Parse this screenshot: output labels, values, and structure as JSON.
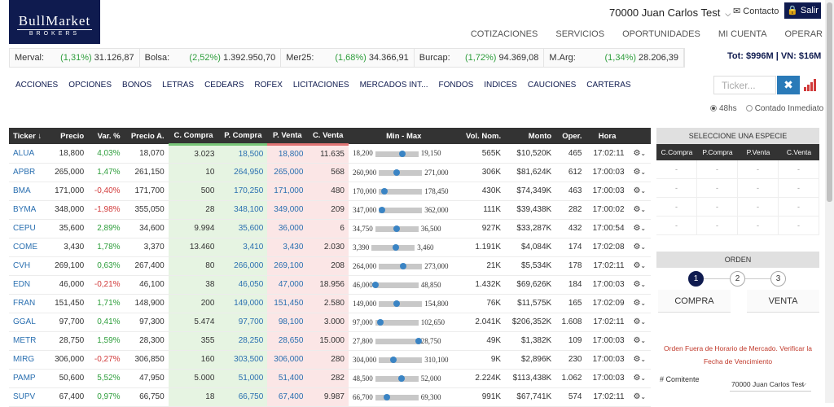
{
  "header": {
    "logo_line1": "BullMarket",
    "logo_line2": "BROKERS",
    "user": "70000 Juan Carlos Test",
    "contact": "Contacto",
    "logout": "Salir",
    "nav": [
      "COTIZACIONES",
      "SERVICIOS",
      "OPORTUNIDADES",
      "MI CUENTA",
      "OPERAR"
    ]
  },
  "ticker_bar": [
    {
      "name": "Merval:",
      "pct": "(1,31%)",
      "value": "31.126,87"
    },
    {
      "name": "Bolsa:",
      "pct": "(2,52%)",
      "value": "1.392.950,70"
    },
    {
      "name": "Mer25:",
      "pct": "(1,68%)",
      "value": "34.366,91"
    },
    {
      "name": "Burcap:",
      "pct": "(1,72%)",
      "value": "94.369,08"
    },
    {
      "name": "M.Arg:",
      "pct": "(1,34%)",
      "value": "28.206,39"
    }
  ],
  "totals": "Tot: $996M | VN: $16M",
  "categories": [
    "ACCIONES",
    "OPCIONES",
    "BONOS",
    "LETRAS",
    "CEDEARS",
    "ROFEX",
    "LICITACIONES",
    "MERCADOS INT...",
    "FONDOS",
    "INDICES",
    "CAUCIONES",
    "CARTERAS"
  ],
  "search": {
    "placeholder": "Ticker..."
  },
  "settlement": {
    "opt1": "48hs",
    "opt2": "Contado Inmediato"
  },
  "table": {
    "headers": [
      "Ticker ↓",
      "Precio",
      "Var. %",
      "Precio A.",
      "C. Compra",
      "P. Compra",
      "P. Venta",
      "C. Venta",
      "Min - Max",
      "Vol. Nom.",
      "Monto",
      "Oper.",
      "Hora"
    ],
    "rows": [
      {
        "ticker": "ALUA",
        "precio": "18,800",
        "var": "4,03%",
        "var_dir": "pos",
        "precio_a": "18,070",
        "c_compra": "3.023",
        "p_compra": "18,500",
        "p_venta": "18,800",
        "c_venta": "11.635",
        "min": "18,200",
        "max": "19,150",
        "pos": 0.63,
        "vol": "565K",
        "monto": "$10,520K",
        "oper": "465",
        "hora": "17:02:11"
      },
      {
        "ticker": "APBR",
        "precio": "265,000",
        "var": "1,47%",
        "var_dir": "pos",
        "precio_a": "261,150",
        "c_compra": "10",
        "p_compra": "264,950",
        "p_venta": "265,000",
        "c_venta": "568",
        "min": "260,900",
        "max": "271,000",
        "pos": 0.41,
        "vol": "306K",
        "monto": "$81,624K",
        "oper": "612",
        "hora": "17:00:03"
      },
      {
        "ticker": "BMA",
        "precio": "171,000",
        "var": "-0,40%",
        "var_dir": "neg",
        "precio_a": "171,700",
        "c_compra": "500",
        "p_compra": "170,250",
        "p_venta": "171,000",
        "c_venta": "480",
        "min": "170,000",
        "max": "178,450",
        "pos": 0.12,
        "vol": "430K",
        "monto": "$74,349K",
        "oper": "463",
        "hora": "17:00:03"
      },
      {
        "ticker": "BYMA",
        "precio": "348,000",
        "var": "-1,98%",
        "var_dir": "neg",
        "precio_a": "355,050",
        "c_compra": "28",
        "p_compra": "348,100",
        "p_venta": "349,000",
        "c_venta": "209",
        "min": "347,000",
        "max": "362,000",
        "pos": 0.07,
        "vol": "111K",
        "monto": "$39,438K",
        "oper": "282",
        "hora": "17:00:02"
      },
      {
        "ticker": "CEPU",
        "precio": "35,600",
        "var": "2,89%",
        "var_dir": "pos",
        "precio_a": "34,600",
        "c_compra": "9.994",
        "p_compra": "35,600",
        "p_venta": "36,000",
        "c_venta": "6",
        "min": "34,750",
        "max": "36,500",
        "pos": 0.49,
        "vol": "927K",
        "monto": "$33,287K",
        "oper": "432",
        "hora": "17:00:54"
      },
      {
        "ticker": "COME",
        "precio": "3,430",
        "var": "1,78%",
        "var_dir": "pos",
        "precio_a": "3,370",
        "c_compra": "13.460",
        "p_compra": "3,410",
        "p_venta": "3,430",
        "c_venta": "2.030",
        "min": "3,390",
        "max": "3,460",
        "pos": 0.57,
        "vol": "1.191K",
        "monto": "$4,084K",
        "oper": "174",
        "hora": "17:02:08"
      },
      {
        "ticker": "CVH",
        "precio": "269,100",
        "var": "0,63%",
        "var_dir": "pos",
        "precio_a": "267,400",
        "c_compra": "80",
        "p_compra": "266,000",
        "p_venta": "269,100",
        "c_venta": "208",
        "min": "264,000",
        "max": "273,000",
        "pos": 0.57,
        "vol": "21K",
        "monto": "$5,534K",
        "oper": "178",
        "hora": "17:02:11"
      },
      {
        "ticker": "EDN",
        "precio": "46,000",
        "var": "-0,21%",
        "var_dir": "neg",
        "precio_a": "46,100",
        "c_compra": "38",
        "p_compra": "46,050",
        "p_venta": "47,000",
        "c_venta": "18.956",
        "min": "46,000",
        "max": "48,850",
        "pos": 0.0,
        "vol": "1.432K",
        "monto": "$69,626K",
        "oper": "184",
        "hora": "17:00:03"
      },
      {
        "ticker": "FRAN",
        "precio": "151,450",
        "var": "1,71%",
        "var_dir": "pos",
        "precio_a": "148,900",
        "c_compra": "200",
        "p_compra": "149,000",
        "p_venta": "151,450",
        "c_venta": "2.580",
        "min": "149,000",
        "max": "154,800",
        "pos": 0.42,
        "vol": "76K",
        "monto": "$11,575K",
        "oper": "165",
        "hora": "17:02:09"
      },
      {
        "ticker": "GGAL",
        "precio": "97,700",
        "var": "0,41%",
        "var_dir": "pos",
        "precio_a": "97,300",
        "c_compra": "5.474",
        "p_compra": "97,700",
        "p_venta": "98,100",
        "c_venta": "3.000",
        "min": "97,000",
        "max": "102,650",
        "pos": 0.12,
        "vol": "2.041K",
        "monto": "$206,352K",
        "oper": "1.608",
        "hora": "17:02:11"
      },
      {
        "ticker": "METR",
        "precio": "28,750",
        "var": "1,59%",
        "var_dir": "pos",
        "precio_a": "28,300",
        "c_compra": "355",
        "p_compra": "28,250",
        "p_venta": "28,650",
        "c_venta": "15.000",
        "min": "27,800",
        "max": "28,750",
        "pos": 1.0,
        "vol": "49K",
        "monto": "$1,382K",
        "oper": "109",
        "hora": "17:00:03"
      },
      {
        "ticker": "MIRG",
        "precio": "306,000",
        "var": "-0,27%",
        "var_dir": "neg",
        "precio_a": "306,850",
        "c_compra": "160",
        "p_compra": "303,500",
        "p_venta": "306,000",
        "c_venta": "280",
        "min": "304,000",
        "max": "310,100",
        "pos": 0.33,
        "vol": "9K",
        "monto": "$2,896K",
        "oper": "230",
        "hora": "17:00:03"
      },
      {
        "ticker": "PAMP",
        "precio": "50,600",
        "var": "5,52%",
        "var_dir": "pos",
        "precio_a": "47,950",
        "c_compra": "5.000",
        "p_compra": "51,000",
        "p_venta": "51,400",
        "c_venta": "282",
        "min": "48,500",
        "max": "52,000",
        "pos": 0.6,
        "vol": "2.224K",
        "monto": "$113,438K",
        "oper": "1.062",
        "hora": "17:00:03"
      },
      {
        "ticker": "SUPV",
        "precio": "67,400",
        "var": "0,97%",
        "var_dir": "pos",
        "precio_a": "66,750",
        "c_compra": "18",
        "p_compra": "66,750",
        "p_venta": "67,400",
        "c_venta": "9.987",
        "min": "66,700",
        "max": "69,300",
        "pos": 0.27,
        "vol": "991K",
        "monto": "$67,741K",
        "oper": "574",
        "hora": "17:02:11"
      }
    ]
  },
  "species_panel": {
    "title": "SELECCIONE UNA ESPECIE",
    "cols": [
      "C.Compra",
      "P.Compra",
      "P.Venta",
      "C.Venta"
    ],
    "rows": [
      [
        "-",
        "-",
        "-",
        "-"
      ],
      [
        "-",
        "-",
        "-",
        "-"
      ],
      [
        "-",
        "-",
        "-",
        "-"
      ],
      [
        "-",
        "-",
        "-",
        "-"
      ]
    ]
  },
  "order_panel": {
    "title": "ORDEN",
    "steps": [
      "1",
      "2",
      "3"
    ],
    "buy": "COMPRA",
    "sell": "VENTA",
    "notice": "Orden Fuera de Horario de Mercado. Verificar la Fecha de Vencimiento",
    "comitente_label": "# Comitente",
    "comitente_value": "70000 Juan Carlos Test"
  },
  "colors": {
    "brand": "#0f1b4f",
    "accent": "#2a7ab8",
    "positive": "#2e9e3c",
    "negative": "#d13a3a"
  }
}
